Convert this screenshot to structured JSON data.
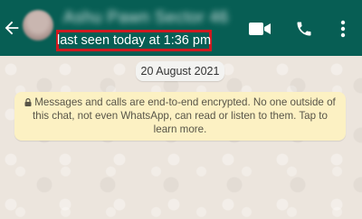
{
  "header": {
    "contact_name": "Ashu Pawn Sector 46",
    "last_seen": "last seen today at 1:36 pm",
    "back_icon": "arrow-left-icon",
    "actions": [
      {
        "name": "video-call",
        "icon": "video-camera-icon"
      },
      {
        "name": "voice-call",
        "icon": "phone-icon"
      },
      {
        "name": "more-options",
        "icon": "more-vertical-icon"
      }
    ],
    "highlight_color": "#d0191f",
    "bar_color": "#075e54"
  },
  "chat": {
    "date_label": "20 August 2021",
    "encryption_notice": "Messages and calls are end-to-end encrypted. No one outside of this chat, not even WhatsApp, can read or listen to them. Tap to learn more."
  }
}
